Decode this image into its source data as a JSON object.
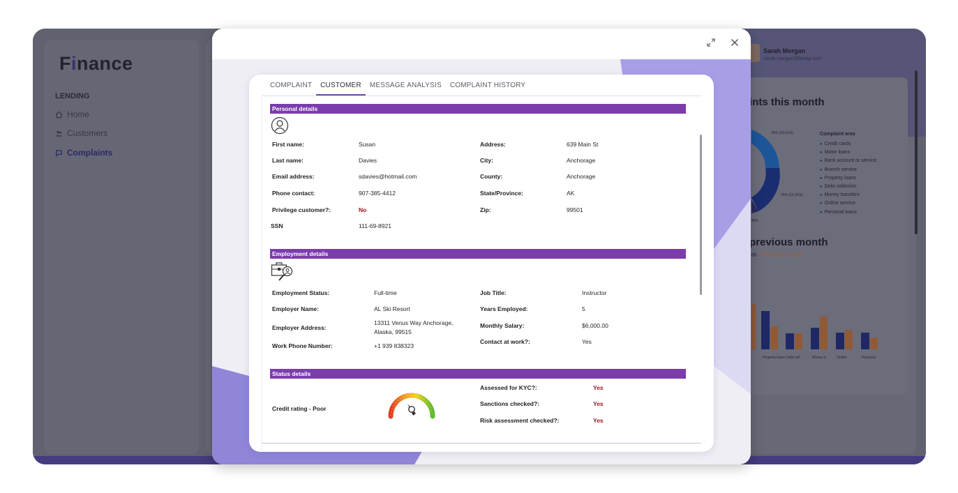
{
  "background": {
    "logo": {
      "prefix": "F",
      "accent": "i",
      "suffix": "nance"
    },
    "sidebar": {
      "section": "LENDING",
      "items": [
        {
          "label": "Home",
          "icon": "home-icon"
        },
        {
          "label": "Customers",
          "icon": "users-icon"
        },
        {
          "label": "Complaints",
          "icon": "complaints-icon",
          "active": true
        }
      ]
    },
    "user": {
      "name": "Sarah Morgan",
      "email": "sarah.morgan@bizagi.com"
    },
    "headings": {
      "this_month": "ints this month",
      "previous_month": "previous month"
    },
    "legend": {
      "title": "Complaint area",
      "items": [
        "Credit cards",
        "Motor loans",
        "Bank account or service",
        "Branch service",
        "Property loans",
        "Debt collection",
        "Money transfers",
        "Online service",
        "Personal loans"
      ]
    },
    "pie_labels": [
      "25% (23.61%)",
      "25% (19.35%)",
      ".35%"
    ],
    "bar_legend": {
      "a": "nth",
      "b": "Previous month"
    }
  },
  "modal": {
    "tabs": [
      {
        "label": "COMPLAINT"
      },
      {
        "label": "CUSTOMER",
        "active": true
      },
      {
        "label": "MESSAGE ANALYSIS"
      },
      {
        "label": "COMPLAINT HISTORY"
      }
    ],
    "personal": {
      "title": "Personal details",
      "first_name_label": "First name:",
      "first_name": "Susan",
      "last_name_label": "Last name:",
      "last_name": "Davies",
      "email_label": "Email address:",
      "email": "sdavies@hotmail.com",
      "phone_label": "Phone contact:",
      "phone": "907-385-4412",
      "privilege_label": "Privilege customer?:",
      "privilege": "No",
      "ssn_label": "SSN",
      "ssn": "111-69-8921",
      "address_label": "Address:",
      "address": "639 Main St",
      "city_label": "City:",
      "city": "Anchorage",
      "county_label": "County:",
      "county": "Anchorage",
      "state_label": "State/Province:",
      "state": "AK",
      "zip_label": "Zip:",
      "zip": "99501"
    },
    "employment": {
      "title": "Employment details",
      "status_label": "Employment Status:",
      "status": "Full-time",
      "employer_label": "Employer Name:",
      "employer": "AL Ski Resort",
      "employer_address_label": "Employer Address:",
      "employer_address_1": "13311 Venus Way Anchorage,",
      "employer_address_2": "Alaska, 99515",
      "work_phone_label": "Work Phone Number:",
      "work_phone": "+1 939 838323",
      "job_title_label": "Job Title:",
      "job_title": "Instructor",
      "years_label": "Years Employed:",
      "years": "5",
      "salary_label": "Monthly Salary:",
      "salary": "$6,000.00",
      "contact_label": "Contact at work?:",
      "contact": "Yes"
    },
    "status": {
      "title": "Status details",
      "credit_label": "Credit rating - Poor",
      "kyc_label": "Assessed for KYC?:",
      "kyc": "Yes",
      "sanctions_label": "Sanctions checked?:",
      "sanctions": "Yes",
      "risk_label": "Risk assessment checked?:",
      "risk": "Yes"
    }
  },
  "colors": {
    "accent": "#7b3cac",
    "tab_underline": "#6b4fa8",
    "alert_red": "#a0161d"
  }
}
